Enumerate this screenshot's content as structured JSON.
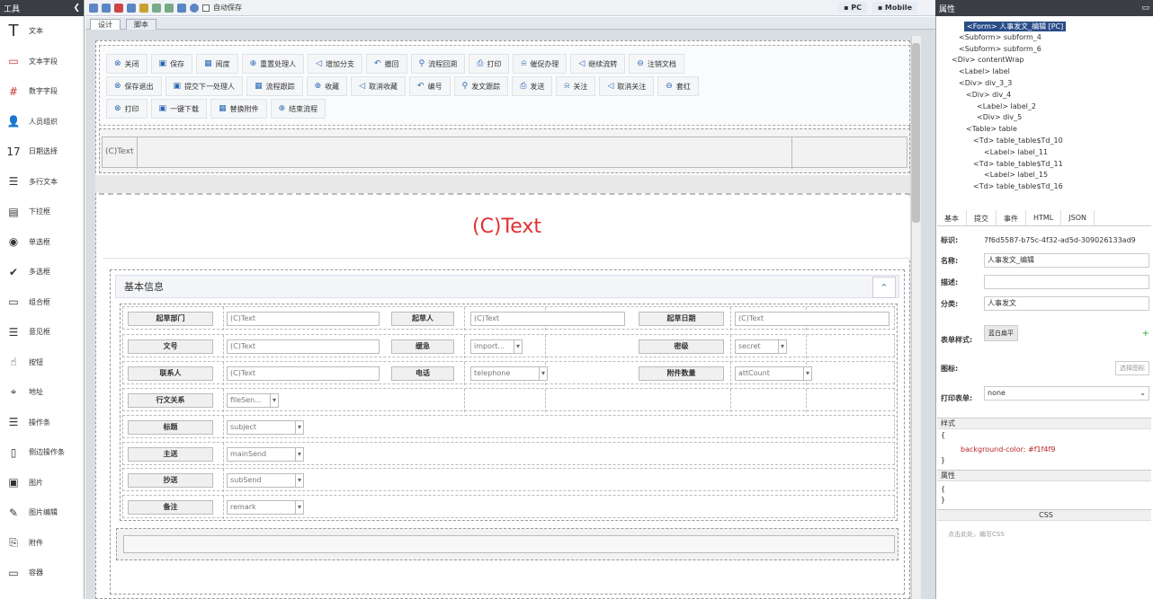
{
  "toolbox": {
    "title": "工具",
    "items": [
      {
        "label": "文本",
        "icon": "text-T-icon"
      },
      {
        "label": "文本字段",
        "icon": "textfield-icon"
      },
      {
        "label": "数字字段",
        "icon": "number-field-icon"
      },
      {
        "label": "人员组织",
        "icon": "person-org-icon"
      },
      {
        "label": "日期选择",
        "icon": "calendar-icon"
      },
      {
        "label": "多行文本",
        "icon": "multiline-icon"
      },
      {
        "label": "下拉框",
        "icon": "dropdown-icon"
      },
      {
        "label": "单选框",
        "icon": "radio-icon"
      },
      {
        "label": "多选框",
        "icon": "checkbox-icon"
      },
      {
        "label": "组合框",
        "icon": "combobox-icon"
      },
      {
        "label": "意见框",
        "icon": "opinion-icon"
      },
      {
        "label": "按钮",
        "icon": "button-hand-icon"
      },
      {
        "label": "地址",
        "icon": "address-icon"
      },
      {
        "label": "操作条",
        "icon": "action-bar-icon"
      },
      {
        "label": "侧边操作条",
        "icon": "side-action-bar-icon"
      },
      {
        "label": "图片",
        "icon": "image-icon"
      },
      {
        "label": "图片编辑",
        "icon": "image-edit-icon"
      },
      {
        "label": "附件",
        "icon": "attachment-icon"
      },
      {
        "label": "容器",
        "icon": "container-icon"
      }
    ]
  },
  "topbar": {
    "autosave": "自动保存",
    "pc": "PC",
    "mobile": "Mobile"
  },
  "designtabs": [
    "设计",
    "脚本"
  ],
  "buttons_row1": [
    "关闭",
    "保存",
    "阅度",
    "重置处理人",
    "增加分支",
    "撤回",
    "流程回溯",
    "打印",
    "催促办理",
    "继续流转",
    "注销文档"
  ],
  "buttons_row2": [
    "保存退出",
    "提交下一处理人",
    "流程跟踪",
    "收藏",
    "取消收藏",
    "编号",
    "发文跟踪",
    "发送",
    "关注",
    "取消关注",
    "套红"
  ],
  "buttons_row3": [
    "打印",
    "一键下载",
    "替换附件",
    "结束流程"
  ],
  "ctext_small": "(C)Text",
  "title_text": "(C)Text",
  "section_title": "基本信息",
  "table": {
    "r1": {
      "l1": "起草部门",
      "v1": "(C)Text",
      "l2": "起草人",
      "v2": "(C)Text",
      "l3": "起草日期",
      "v3": "(C)Text"
    },
    "r2": {
      "l1": "文号",
      "v1": "(C)Text",
      "l2": "缓急",
      "v2": "import...",
      "l3": "密级",
      "v3": "secret"
    },
    "r3": {
      "l1": "联系人",
      "v1": "(C)Text",
      "l2": "电话",
      "v2": "telephone",
      "l3": "附件数量",
      "v3": "attCount"
    },
    "r4": {
      "l1": "行文关系",
      "v1": "fileSen..."
    },
    "r5": {
      "l1": "标题",
      "v1": "subject"
    },
    "r6": {
      "l1": "主送",
      "v1": "mainSend"
    },
    "r7": {
      "l1": "抄送",
      "v1": "subSend"
    },
    "r8": {
      "l1": "备注",
      "v1": "remark"
    }
  },
  "rightpanel": {
    "title": "属性",
    "tree": [
      "<Form> 人事发文_编辑 [PC]",
      "<Subform> subform_4",
      "<Subform> subform_6",
      "<Div> contentWrap",
      "<Label> label",
      "<Div> div_3_3",
      "<Div> div_4",
      "<Label> label_2",
      "<Div> div_5",
      "<Table> table",
      "<Td> table_table$Td_10",
      "<Label> label_11",
      "<Td> table_table$Td_11",
      "<Label> label_15",
      "<Td> table_table$Td_16"
    ],
    "tabs": [
      "基本",
      "提交",
      "事件",
      "HTML",
      "JSON"
    ],
    "id_label": "标识:",
    "id_value": "7f6d5587-b75c-4f32-ad5d-309026133ad9",
    "name_label": "名称:",
    "name_value": "人事发文_编辑",
    "desc_label": "描述:",
    "cat_label": "分类:",
    "cat_value": "人事发文",
    "style_label": "表单样式:",
    "style_value": "蓝白扁平",
    "icon_label": "图标:",
    "icon_btn": "选择图标",
    "print_label": "打印表单:",
    "print_value": "none",
    "style_sec": "样式",
    "style_open": "{",
    "style_css": "background-color: #f1f4f9",
    "style_close": "}",
    "attr_sec": "属性",
    "attr_open": "{",
    "attr_close": "}",
    "css_sec": "CSS",
    "css_hint": "点击此处，编写CSS"
  }
}
